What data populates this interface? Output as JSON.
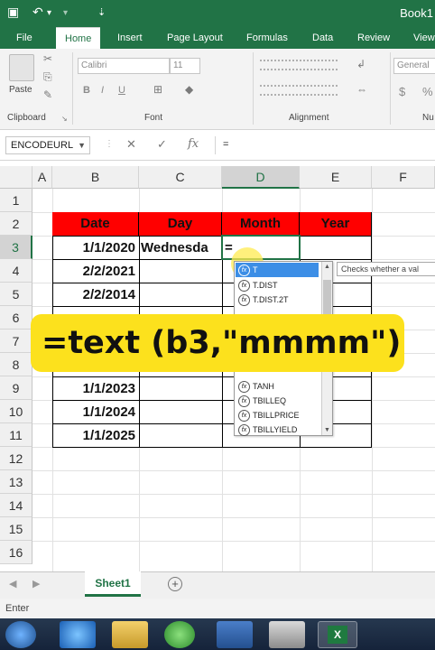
{
  "titlebar": {
    "title": "Book1",
    "save_glyph": "▣",
    "undo_glyph": "↶",
    "dropdown_glyph": "▾",
    "customize_glyph": "⇣"
  },
  "tabs": [
    "File",
    "Home",
    "Insert",
    "Page Layout",
    "Formulas",
    "Data",
    "Review",
    "View"
  ],
  "ribbon": {
    "paste_label": "Paste",
    "clipboard_label": "Clipboard",
    "font_label": "Font",
    "alignment_label": "Alignment",
    "number_label_partial": "Nu",
    "font_name": "Calibri",
    "font_size": "11",
    "number_format": "General",
    "bold": "B",
    "italic": "I",
    "underline": "U",
    "currency": "$",
    "percent": "%"
  },
  "formula_bar": {
    "name_box": "ENCODEURL",
    "cancel_glyph": "✕",
    "enter_glyph": "✓",
    "fx_label": "fx",
    "content": "="
  },
  "columns": [
    "A",
    "B",
    "C",
    "D",
    "E",
    "F"
  ],
  "rows": [
    "1",
    "2",
    "3",
    "4",
    "5",
    "6",
    "7",
    "8",
    "9",
    "10",
    "11",
    "12",
    "13",
    "14",
    "15",
    "16"
  ],
  "table": {
    "headers": [
      "Date",
      "Day",
      "Month",
      "Year"
    ],
    "dates": [
      "1/1/2020",
      "2/2/2021",
      "2/2/2014",
      "",
      "",
      "",
      "1/1/2023",
      "1/1/2024",
      "1/1/2025"
    ],
    "day_c3": "Wednesda",
    "editing_d3": "="
  },
  "autocomplete": {
    "items": [
      "T",
      "T.DIST",
      "T.DIST.2T",
      "",
      "",
      "",
      "",
      "TANH",
      "TBILLEQ",
      "TBILLPRICE",
      "TBILLYIELD"
    ],
    "tooltip": "Checks whether a val"
  },
  "banner_text": "=text (b3,\"mmmm\")",
  "sheet_tab": "Sheet1",
  "status": "Enter",
  "colors": {
    "excel_green": "#217346",
    "header_red": "#ff0000",
    "banner_yellow": "#fce11d"
  }
}
